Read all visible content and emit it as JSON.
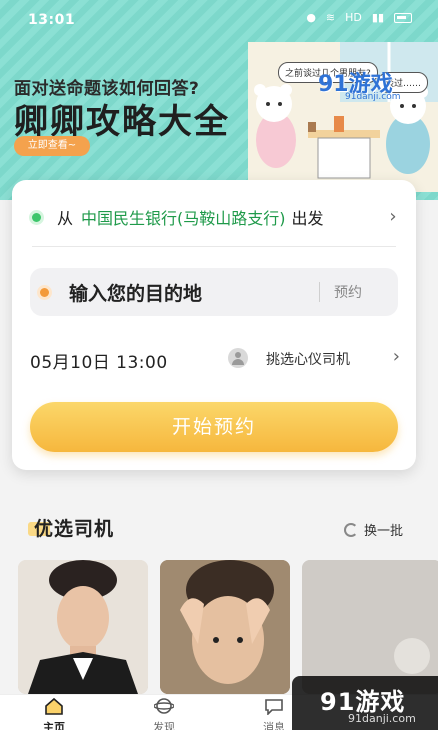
{
  "status": {
    "time": "13:01",
    "network": "HD",
    "battery": "68"
  },
  "banner": {
    "question": "面对送命题该如何回答?",
    "title": "卿卿攻略大全",
    "button": "立即查看~",
    "bubble_left": "之前谈过几个男朋友?",
    "bubble_right": "谈过……",
    "watermark": "91游戏",
    "watermark_sub": "91danji.com"
  },
  "booking": {
    "from_prefix": "从",
    "from_place": "中国民生银行(马鞍山路支行)",
    "from_suffix": "出发",
    "destination_placeholder": "输入您的目的地",
    "reserve_label": "预约",
    "datetime": "05月10日 13:00",
    "driver_pick": "挑选心仪司机",
    "start_button": "开始预约"
  },
  "drivers": {
    "title": "优选司机",
    "refresh": "换一批"
  },
  "tabs": [
    {
      "label": "主页",
      "icon": "home-icon"
    },
    {
      "label": "发现",
      "icon": "planet-icon"
    },
    {
      "label": "消息",
      "icon": "message-icon"
    }
  ],
  "corner_watermark": {
    "main": "91游戏",
    "sub": "91danji.com"
  },
  "colors": {
    "accent_green": "#1f9a4a",
    "accent_orange": "#f39a3a",
    "cta_yellow": "#f6b73d",
    "banner_teal": "#8be0d4"
  }
}
